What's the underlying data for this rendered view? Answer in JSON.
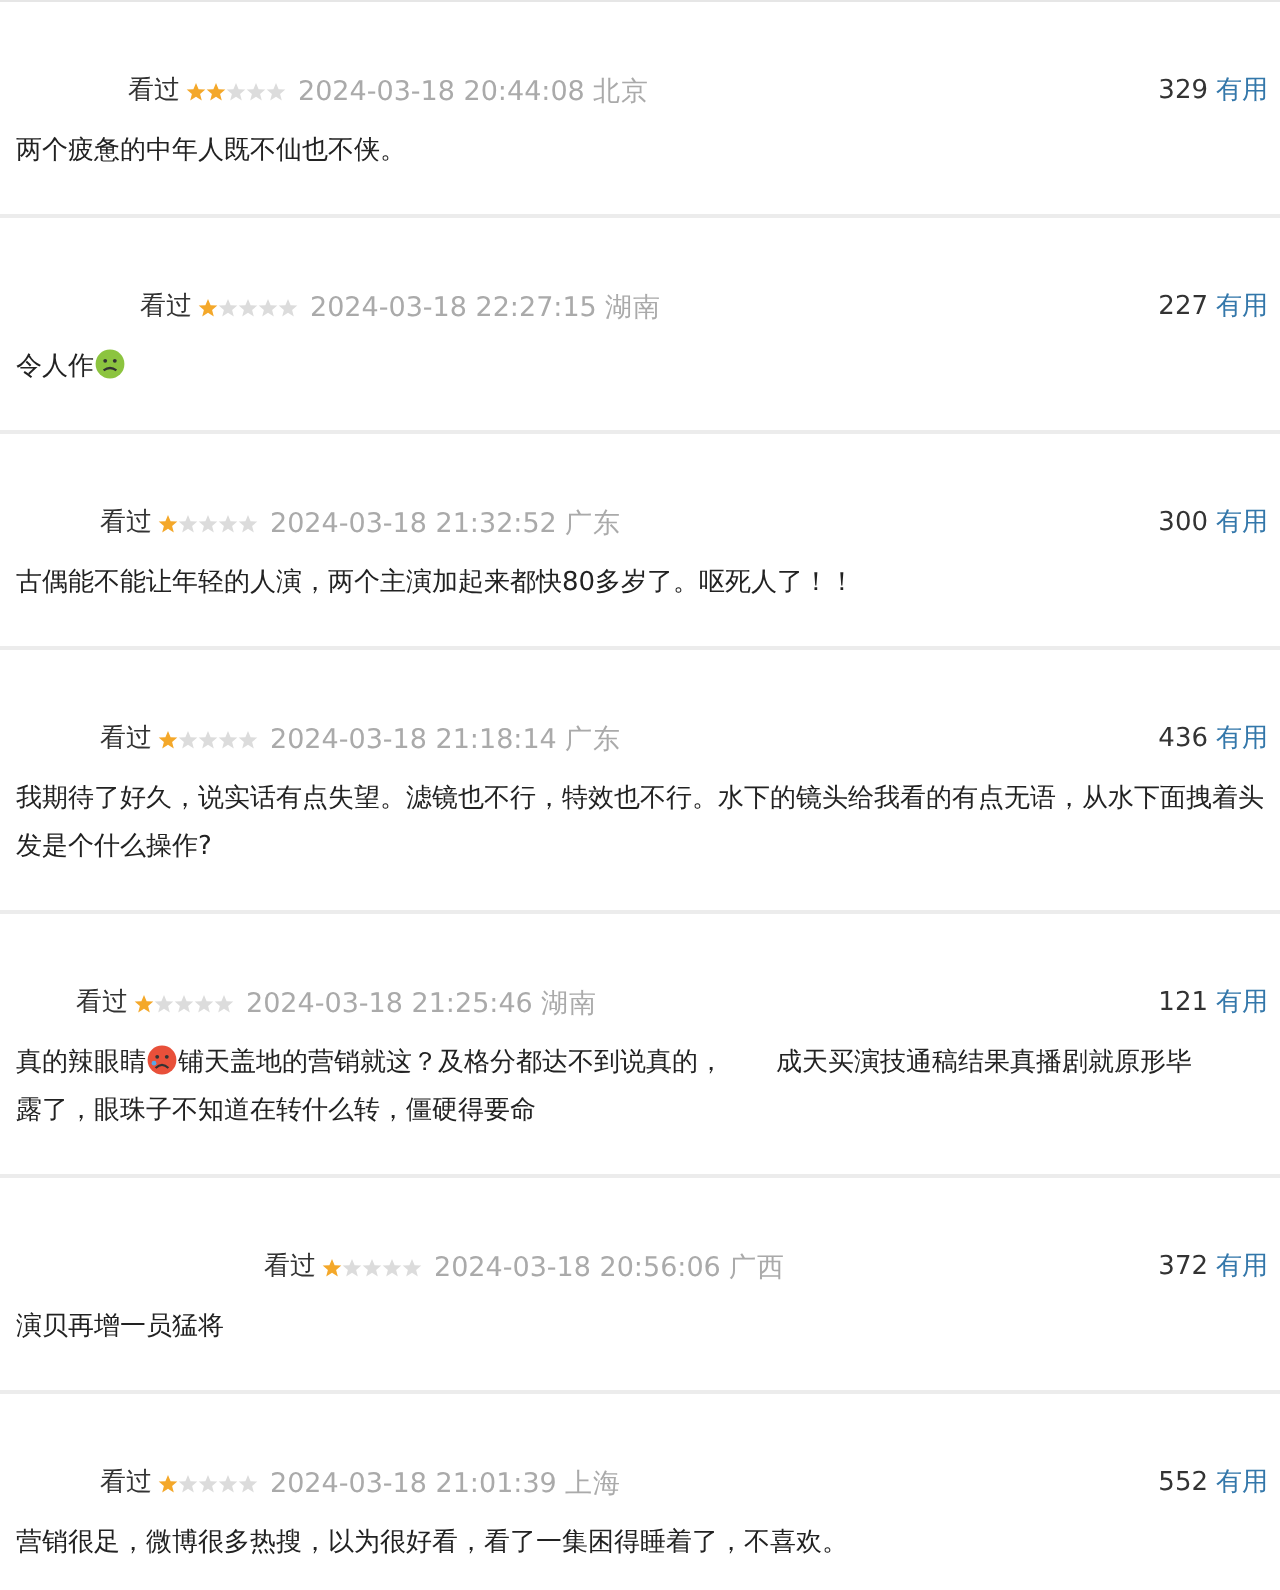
{
  "reviews": [
    {
      "status": "看过",
      "stars": 2,
      "time": "2024-03-18 20:44:08",
      "location": "北京",
      "votes": "329",
      "useful": "有用",
      "content": [
        {
          "kind": "text",
          "text": "两个疲惫的中年人既不仙也不侠。"
        }
      ]
    },
    {
      "status": "看过",
      "stars": 1,
      "time": "2024-03-18 22:27:15",
      "location": "湖南",
      "votes": "227",
      "useful": "有用",
      "content": [
        {
          "kind": "text",
          "text": "令人作"
        },
        {
          "kind": "nausea"
        }
      ]
    },
    {
      "status": "看过",
      "stars": 1,
      "time": "2024-03-18 21:32:52",
      "location": "广东",
      "votes": "300",
      "useful": "有用",
      "content": [
        {
          "kind": "text",
          "text": "古偶能不能让年轻的人演，两个主演加起来都快80多岁了。呕死人了！！"
        }
      ]
    },
    {
      "status": "看过",
      "stars": 1,
      "time": "2024-03-18 21:18:14",
      "location": "广东",
      "votes": "436",
      "useful": "有用",
      "content": [
        {
          "kind": "text",
          "text": "我期待了好久，说实话有点失望。滤镜也不行，特效也不行。水下的镜头给我看的有点无语，从水下面拽着头发是个什么操作?"
        }
      ]
    },
    {
      "status": "看过",
      "stars": 1,
      "time": "2024-03-18 21:25:46",
      "location": "湖南",
      "votes": "121",
      "useful": "有用",
      "content": [
        {
          "kind": "text",
          "text": "真的辣眼睛"
        },
        {
          "kind": "flushed"
        },
        {
          "kind": "text",
          "text": "铺天盖地的营销就这？及格分都达不到说真的，"
        },
        {
          "kind": "redacted"
        },
        {
          "kind": "text",
          "text": "成天买演技通稿结果真播剧就原形毕"
        },
        {
          "kind": "text",
          "text": "露了，眼珠子不知道在转什么转，僵硬得要命"
        }
      ]
    },
    {
      "status": "看过",
      "stars": 1,
      "time": "2024-03-18 20:56:06",
      "location": "广西",
      "votes": "372",
      "useful": "有用",
      "content": [
        {
          "kind": "text",
          "text": "演贝再增一员猛将"
        }
      ]
    },
    {
      "status": "看过",
      "stars": 1,
      "time": "2024-03-18 21:01:39",
      "location": "上海",
      "votes": "552",
      "useful": "有用",
      "content": [
        {
          "kind": "text",
          "text": "营销很足，微博很多热搜，以为很好看，看了一集困得睡着了，不喜欢。"
        }
      ]
    }
  ]
}
